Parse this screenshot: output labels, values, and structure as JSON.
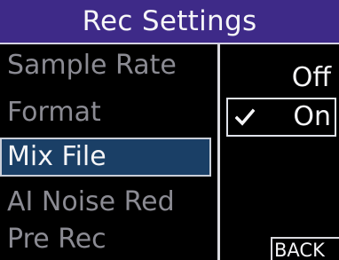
{
  "header": {
    "title": "Rec Settings"
  },
  "menu": {
    "items": [
      {
        "label": "Sample Rate"
      },
      {
        "label": "Format"
      },
      {
        "label": "Mix File",
        "selected": true
      },
      {
        "label": "AI Noise Red"
      },
      {
        "label": "Pre Rec"
      }
    ]
  },
  "options": {
    "items": [
      {
        "label": "Off",
        "checked": false
      },
      {
        "label": "On",
        "checked": true
      }
    ],
    "check_icon": "checkmark-icon"
  },
  "footer": {
    "back_label": "BACK"
  },
  "colors": {
    "title_bar": "#3e2a88",
    "selected_item": "#1a3f66",
    "inactive_text": "#8b8b93",
    "active_text": "#f4f4f6",
    "background": "#000000"
  }
}
